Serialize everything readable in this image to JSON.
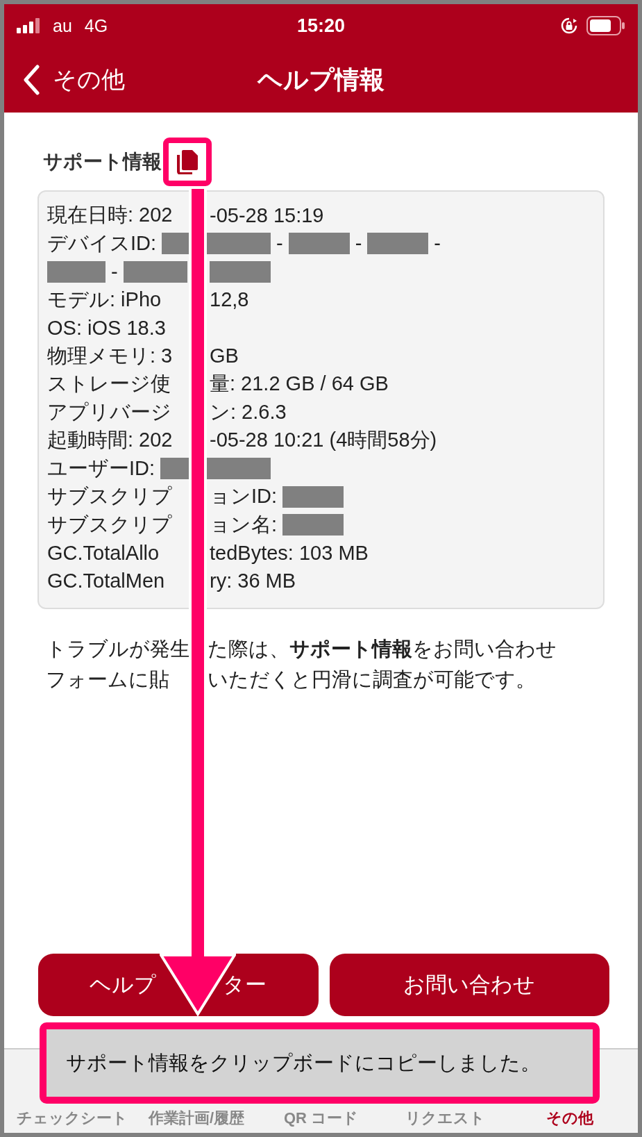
{
  "status_bar": {
    "carrier": "au",
    "network": "4G",
    "time": "15:20"
  },
  "nav": {
    "back_label": "その他",
    "title": "ヘルプ情報"
  },
  "section": {
    "label": "サポート情報"
  },
  "info_lines": [
    {
      "left": [
        {
          "kind": "text",
          "text": "現在日時: 202"
        }
      ],
      "right": [
        {
          "kind": "text",
          "text": "-05-28 15:19"
        }
      ]
    },
    {
      "left": [
        {
          "kind": "text",
          "text": "デバイスID:"
        },
        {
          "kind": "redacted"
        }
      ],
      "right": [
        {
          "kind": "redacted"
        },
        {
          "kind": "text",
          "text": "-"
        },
        {
          "kind": "redacted"
        },
        {
          "kind": "text",
          "text": "-"
        },
        {
          "kind": "redacted"
        },
        {
          "kind": "text",
          "text": "-"
        }
      ]
    },
    {
      "left": [
        {
          "kind": "redacted"
        },
        {
          "kind": "text",
          "text": "-"
        },
        {
          "kind": "redacted"
        }
      ],
      "right": [
        {
          "kind": "redacted"
        }
      ]
    },
    {
      "left": [
        {
          "kind": "text",
          "text": "モデル: iPho"
        }
      ],
      "right": [
        {
          "kind": "text",
          "text": "12,8"
        }
      ]
    },
    {
      "left": [
        {
          "kind": "text",
          "text": "OS: iOS 18.3"
        }
      ]
    },
    {
      "left": [
        {
          "kind": "text",
          "text": "物理メモリ: 3"
        }
      ],
      "right": [
        {
          "kind": "text",
          "text": "GB"
        }
      ]
    },
    {
      "left": [
        {
          "kind": "text",
          "text": "ストレージ使"
        }
      ],
      "right": [
        {
          "kind": "text",
          "text": "量: 21.2 GB / 64 GB"
        }
      ]
    },
    {
      "left": [
        {
          "kind": "text",
          "text": "アプリバージ"
        }
      ],
      "right": [
        {
          "kind": "text",
          "text": "ン: 2.6.3"
        }
      ]
    },
    {
      "left": [
        {
          "kind": "text",
          "text": "起動時間: 202"
        }
      ],
      "right": [
        {
          "kind": "text",
          "text": "-05-28 10:21 (4時間58分)"
        }
      ]
    },
    {
      "left": [
        {
          "kind": "text",
          "text": "ユーザーID:"
        },
        {
          "kind": "redacted"
        }
      ],
      "right": [
        {
          "kind": "redacted"
        }
      ]
    },
    {
      "left": [
        {
          "kind": "text",
          "text": "サブスクリプ"
        }
      ],
      "right": [
        {
          "kind": "text",
          "text": "ョンID:"
        },
        {
          "kind": "redacted"
        }
      ]
    },
    {
      "left": [
        {
          "kind": "text",
          "text": "サブスクリプ"
        }
      ],
      "right": [
        {
          "kind": "text",
          "text": "ョン名:"
        },
        {
          "kind": "redacted"
        }
      ]
    },
    {
      "left": [
        {
          "kind": "text",
          "text": "GC.TotalAllo"
        }
      ],
      "right": [
        {
          "kind": "text",
          "text": "tedBytes: 103 MB"
        }
      ]
    },
    {
      "left": [
        {
          "kind": "text",
          "text": "GC.TotalMen"
        }
      ],
      "right": [
        {
          "kind": "text",
          "text": "ry: 36 MB"
        }
      ]
    }
  ],
  "note_lines": [
    {
      "left": "トラブルが発生",
      "right": "た際は、**サポート情報**をお問い合わせ"
    },
    {
      "left": "フォームに貼",
      "right": "いただくと円滑に調査が可能です。"
    }
  ],
  "buttons": [
    {
      "label_parts": [
        "ヘルプ",
        "ター"
      ]
    },
    {
      "label_parts": [
        "お問い合わせ"
      ]
    }
  ],
  "toast": {
    "message": "サポート情報をクリップボードにコピーしました。"
  },
  "tabs": [
    {
      "label": "チェックシート",
      "selected": false
    },
    {
      "label": "作業計画/履歴",
      "selected": false
    },
    {
      "label": "QR コード",
      "selected": false
    },
    {
      "label": "リクエスト",
      "selected": false
    },
    {
      "label": "その他",
      "selected": true
    }
  ]
}
